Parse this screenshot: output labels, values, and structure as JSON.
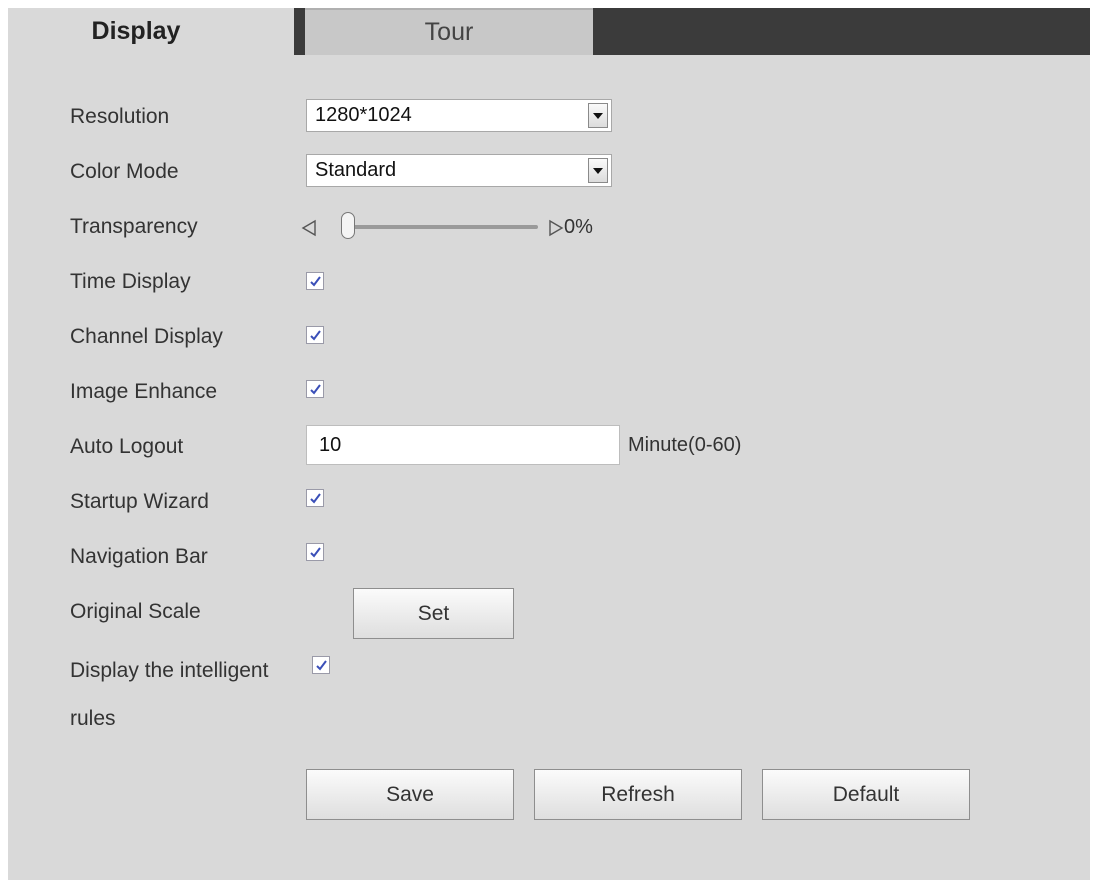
{
  "tabs": [
    {
      "label": "Display",
      "active": true
    },
    {
      "label": "Tour",
      "active": false
    }
  ],
  "form": {
    "resolution": {
      "label": "Resolution",
      "value": "1280*1024"
    },
    "color_mode": {
      "label": "Color Mode",
      "value": "Standard"
    },
    "transparency": {
      "label": "Transparency",
      "value_text": "0%",
      "level": 0
    },
    "time_display": {
      "label": "Time Display",
      "checked": true
    },
    "channel_display": {
      "label": "Channel Display",
      "checked": true
    },
    "image_enhance": {
      "label": "Image Enhance",
      "checked": true
    },
    "auto_logout": {
      "label": "Auto Logout",
      "value": "10",
      "unit": "Minute(0-60)"
    },
    "startup_wizard": {
      "label": "Startup Wizard",
      "checked": true
    },
    "navigation_bar": {
      "label": "Navigation Bar",
      "checked": true
    },
    "original_scale": {
      "label": "Original Scale",
      "button": "Set"
    },
    "intelligent_rules": {
      "label_line1": "Display the intelligent",
      "label_line2": "rules",
      "checked": true
    }
  },
  "actions": {
    "save": "Save",
    "refresh": "Refresh",
    "default": "Default"
  },
  "colors": {
    "panel_bg": "#d9d9d9",
    "tabbar_bg": "#3b3b3b",
    "check_color": "#3a4fb8"
  }
}
